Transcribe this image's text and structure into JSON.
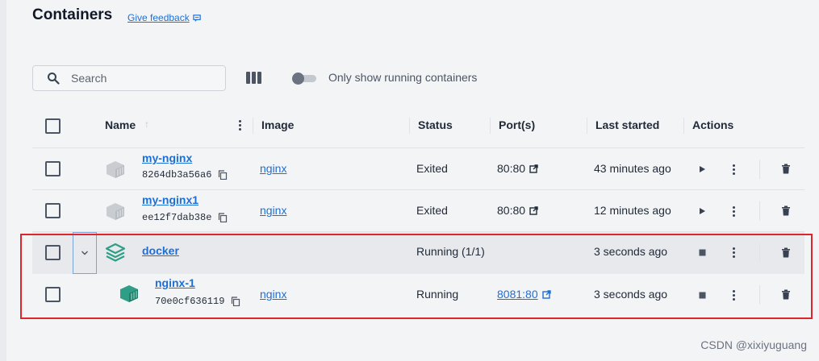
{
  "page": {
    "title": "Containers",
    "feedback_label": "Give feedback"
  },
  "toolbar": {
    "search_placeholder": "Search",
    "toggle_label": "Only show running containers"
  },
  "table": {
    "headers": {
      "name": "Name",
      "image": "Image",
      "status": "Status",
      "ports": "Port(s)",
      "last_started": "Last started",
      "actions": "Actions"
    },
    "rows": [
      {
        "name": "my-nginx",
        "id": "8264db3a56a6",
        "image": "nginx",
        "status": "Exited",
        "port": "80:80",
        "last_started": "43 minutes ago",
        "state": "stopped"
      },
      {
        "name": "my-nginx1",
        "id": "ee12f7dab38e",
        "image": "nginx",
        "status": "Exited",
        "port": "80:80",
        "last_started": "12 minutes ago",
        "state": "stopped"
      }
    ],
    "group": {
      "name": "docker",
      "status": "Running (1/1)",
      "last_started": "3 seconds ago",
      "expanded": true,
      "children": [
        {
          "name": "nginx-1",
          "id": "70e0cf636119",
          "image": "nginx",
          "status": "Running",
          "port": "8081:80",
          "last_started": "3 seconds ago",
          "state": "running"
        }
      ]
    }
  },
  "colors": {
    "link": "#1d6fd8",
    "highlight": "#e0242c",
    "group_icon": "#2e9e86",
    "stopped_icon": "#c9ccd1"
  },
  "icons": {
    "search": "search-icon",
    "columns": "columns-icon",
    "copy": "copy-icon",
    "external": "external-link-icon",
    "play": "play-icon",
    "stop": "stop-icon",
    "more": "more-vertical-icon",
    "trash": "trash-icon",
    "container": "container-icon",
    "stack": "stack-icon",
    "chevron": "chevron-down-icon"
  },
  "watermark": "CSDN @xixiyuguang"
}
